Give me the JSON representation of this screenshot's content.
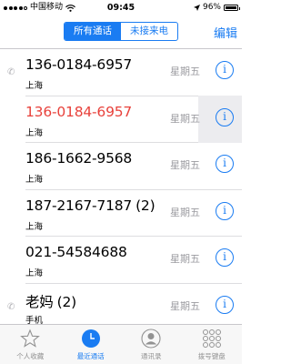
{
  "status_bar": {
    "carrier": "中国移动",
    "time": "09:45",
    "battery": "96%"
  },
  "nav": {
    "segments": [
      "所有通话",
      "未接来电"
    ],
    "edit_label": "编辑"
  },
  "calls": [
    {
      "name": "136-0184-6957",
      "count": "",
      "sub": "上海",
      "day": "星期五",
      "missed": false
    },
    {
      "name": "136-0184-6957",
      "count": "",
      "sub": "上海",
      "day": "星期五",
      "missed": true
    },
    {
      "name": "186-1662-9568",
      "count": "",
      "sub": "上海",
      "day": "星期五",
      "missed": false
    },
    {
      "name": "187-2167-7187",
      "count": "(2)",
      "sub": "上海",
      "day": "星期五",
      "missed": false
    },
    {
      "name": "021-54584688",
      "count": "",
      "sub": "上海",
      "day": "星期五",
      "missed": false
    },
    {
      "name": "老妈",
      "count": "(2)",
      "sub": "手机",
      "day": "星期五",
      "missed": false
    }
  ],
  "tabs": [
    {
      "label": "个人收藏",
      "icon": "star-icon"
    },
    {
      "label": "最近通话",
      "icon": "clock-icon"
    },
    {
      "label": "通讯录",
      "icon": "contacts-icon"
    },
    {
      "label": "拨号键盘",
      "icon": "keypad-icon"
    }
  ],
  "colors": {
    "accent": "#1a7cf2",
    "missed": "#e8413b"
  }
}
